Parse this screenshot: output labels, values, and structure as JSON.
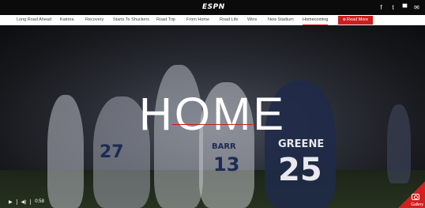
{
  "header": {
    "logo": "ESPN",
    "social": [
      {
        "icon": "facebook-icon",
        "glyph": "f"
      },
      {
        "icon": "twitter-icon",
        "glyph": "t"
      },
      {
        "icon": "comment-icon",
        "glyph": "▀"
      },
      {
        "icon": "email-icon",
        "glyph": "✉"
      }
    ]
  },
  "nav": {
    "items": [
      "Long Road Ahead",
      "Katrina",
      "Recovery",
      "Starts To Shuckers",
      "Road Trip",
      "From Home",
      "Road Life",
      "Wins",
      "New Stadium",
      "Homecoming"
    ],
    "active": "Homecoming",
    "read_more": "Read More",
    "read_more_icon": "⊕"
  },
  "hero": {
    "title": "HOME",
    "jerseys": [
      "27",
      "13",
      "25"
    ],
    "names": [
      "GREENE",
      "BARR"
    ],
    "accent_color": "#c81e1e"
  },
  "player": {
    "play_icon": "▶",
    "volume_icon": "◀)",
    "time": "0:58"
  },
  "gallery": {
    "label": "Gallery"
  }
}
